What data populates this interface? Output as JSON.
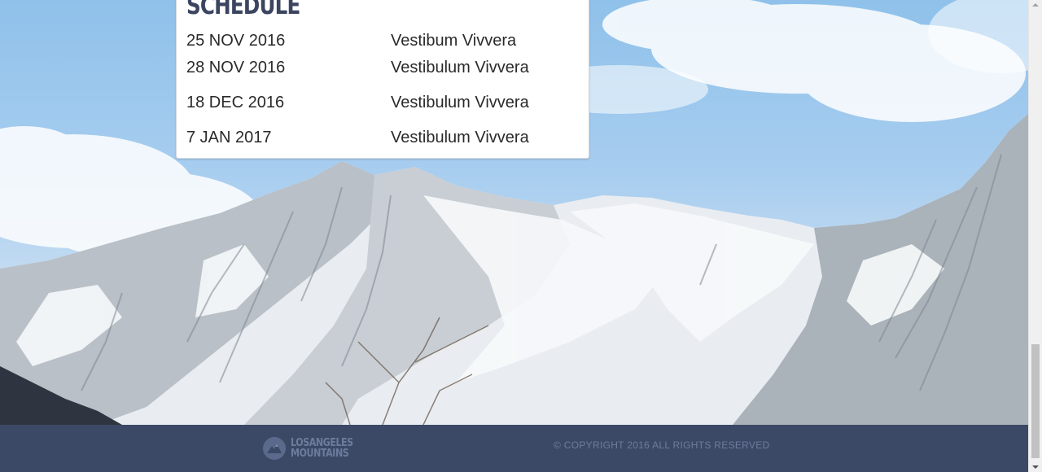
{
  "schedule": {
    "title": "SCHEDULE",
    "rows": [
      {
        "date": "25 NOV 2016",
        "event": "Vestibum Vivvera"
      },
      {
        "date": "28 NOV 2016",
        "event": "Vestibulum Vivvera"
      },
      {
        "date": "18 DEC 2016",
        "event": "Vestibulum Vivvera"
      },
      {
        "date": "7 JAN 2017",
        "event": "Vestibulum Vivvera"
      }
    ]
  },
  "footer": {
    "logo_line1": "LOSANGELES",
    "logo_line2": "MOUNTAINS",
    "copyright": "© COPYRIGHT 2016 ALL RIGHTS RESERVED"
  },
  "colors": {
    "footer_bg": "#3c4966",
    "footer_text": "#6d7c9d",
    "title": "#3b4560"
  },
  "icons": {
    "logo": "mountain-logo-icon"
  }
}
